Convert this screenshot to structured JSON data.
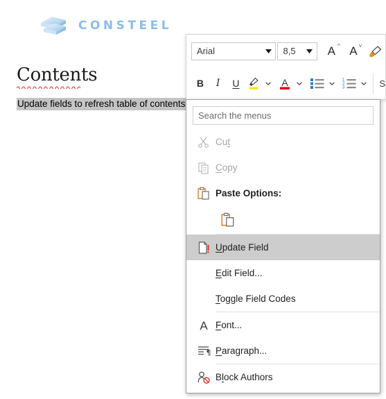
{
  "document": {
    "brand_wordmark": "CONSTEEL",
    "brand_color": "#8cbde8",
    "heading": "Contents",
    "toc_placeholder": "Update fields to refresh table of contents",
    "selection_highlight_color": "#c4c4c4",
    "page_background": "#ffffff"
  },
  "mini_toolbar": {
    "font_name": "Arial",
    "font_size": "8,5",
    "trailing_label": "S",
    "buttons": {
      "grow_font": "A",
      "shrink_font": "A",
      "format_painter": "format-painter",
      "bold": "B",
      "italic": "I",
      "underline": "U",
      "highlight": "text-highlight",
      "font_color": "A",
      "bullets": "bullet-list",
      "numbering": "numbered-list"
    },
    "accent_blue": "#2b7fc4",
    "highlight_swatch": "#ffe600",
    "font_color_swatch": "#e00000",
    "painter_orange": "#e8881c"
  },
  "context_menu": {
    "search_placeholder": "Search the menus",
    "search_value": "",
    "items": [
      {
        "id": "cut",
        "label": "Cut",
        "icon": "scissors-icon",
        "disabled": true,
        "accel_before": "Cu",
        "accel_char": "t",
        "accel_after": ""
      },
      {
        "id": "copy",
        "label": "Copy",
        "icon": "copy-icon",
        "disabled": true,
        "accel_before": "",
        "accel_char": "C",
        "accel_after": "opy"
      },
      {
        "id": "paste-options",
        "label": "Paste Options:",
        "icon": "clipboard-icon",
        "disabled": false,
        "bold": true
      }
    ],
    "paste_gallery": [
      {
        "id": "keep-source-formatting",
        "icon": "clipboard-icon"
      }
    ],
    "field_items": [
      {
        "id": "update-field",
        "label": "Update Field",
        "icon": "field-update-icon",
        "selected": true,
        "accel_before": "",
        "accel_char": "U",
        "accel_after": "pdate Field"
      },
      {
        "id": "edit-field",
        "label": "Edit Field...",
        "icon": "",
        "selected": false,
        "accel_before": "",
        "accel_char": "E",
        "accel_after": "dit Field..."
      },
      {
        "id": "toggle-field-codes",
        "label": "Toggle Field Codes",
        "icon": "",
        "selected": false,
        "accel_before": "",
        "accel_char": "T",
        "accel_after": "oggle Field Codes"
      }
    ],
    "format_items": [
      {
        "id": "font",
        "label": "Font...",
        "icon": "font-a-icon",
        "accel_before": "",
        "accel_char": "F",
        "accel_after": "ont..."
      },
      {
        "id": "paragraph",
        "label": "Paragraph...",
        "icon": "paragraph-icon",
        "accel_before": "",
        "accel_char": "P",
        "accel_after": "aragraph..."
      }
    ],
    "protection_items": [
      {
        "id": "block-authors",
        "label": "Block Authors",
        "icon": "block-authors-icon",
        "accel_before": "B",
        "accel_char": "l",
        "accel_after": "ock Authors"
      }
    ],
    "selected_row_color": "#cdcdcd"
  }
}
